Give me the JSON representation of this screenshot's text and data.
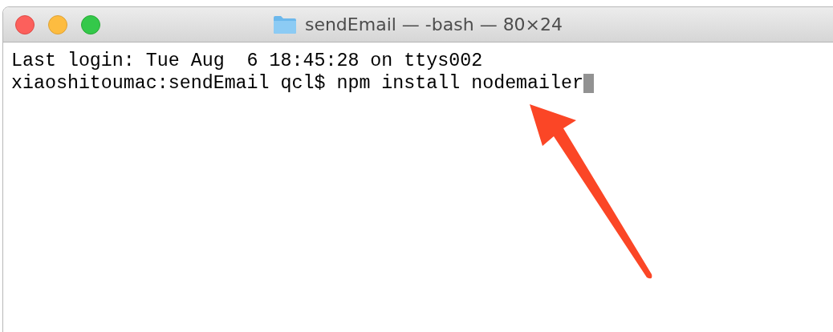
{
  "window": {
    "title": "sendEmail — -bash — 80×24"
  },
  "terminal": {
    "lines": [
      "Last login: Tue Aug  6 18:45:28 on ttys002",
      "xiaoshitoumac:sendEmail qcl$ npm install nodemailer"
    ],
    "cursor": true
  }
}
